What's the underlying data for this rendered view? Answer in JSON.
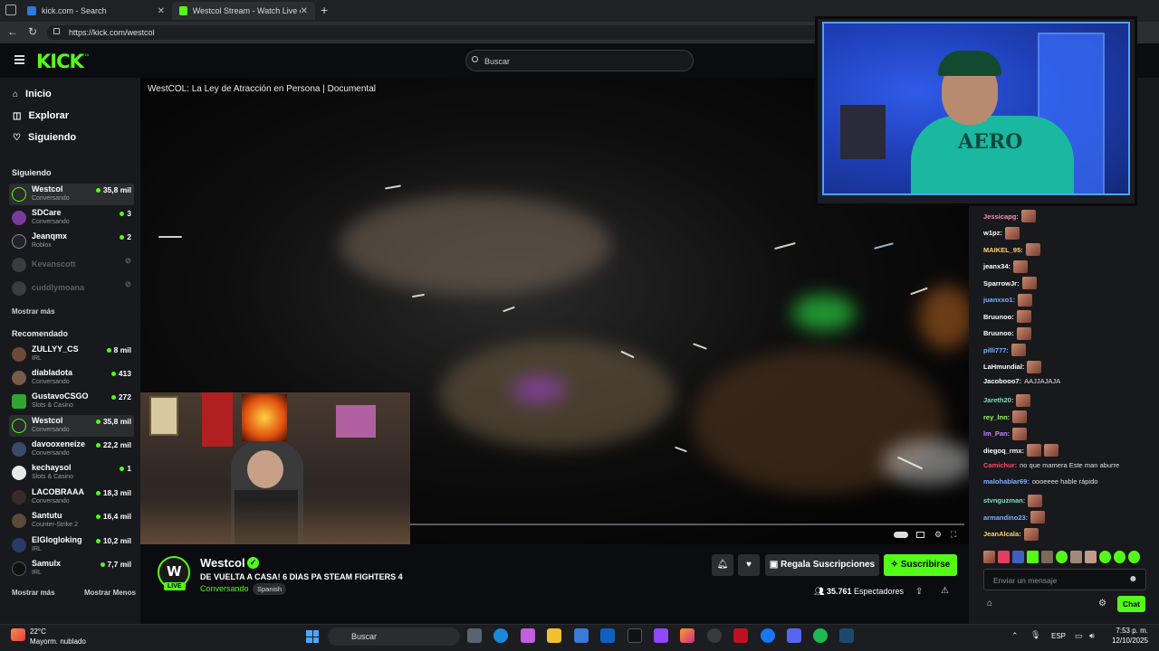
{
  "browser": {
    "tabs": [
      {
        "label": "kick.com - Search"
      },
      {
        "label": "Westcol Stream - Watch Live on K"
      }
    ],
    "url": "https://kick.com/westcol"
  },
  "header": {
    "logo": "KICK",
    "logo_badge": "BETA",
    "search_placeholder": "Buscar"
  },
  "sidebar": {
    "nav": [
      {
        "label": "Inicio",
        "icon": "home-icon"
      },
      {
        "label": "Explorar",
        "icon": "compass-icon"
      },
      {
        "label": "Siguiendo",
        "icon": "heart-icon"
      }
    ],
    "following_title": "Siguiendo",
    "following": [
      {
        "name": "Westcol",
        "category": "Conversando",
        "viewers": "35,8 mil"
      },
      {
        "name": "SDCare",
        "category": "Conversando",
        "viewers": "3"
      },
      {
        "name": "Jeanqmx",
        "category": "Roblox",
        "viewers": "2"
      },
      {
        "name": "Kevanscott",
        "category": "",
        "viewers": ""
      },
      {
        "name": "cuddlymoana",
        "category": "",
        "viewers": ""
      }
    ],
    "show_more": "Mostrar más",
    "recommended_title": "Recomendado",
    "recommended": [
      {
        "name": "ZULLYY_CS",
        "category": "IRL",
        "viewers": "8 mil"
      },
      {
        "name": "diabladota",
        "category": "Conversando",
        "viewers": "413"
      },
      {
        "name": "GustavoCSGO",
        "category": "Slots & Casino",
        "viewers": "272"
      },
      {
        "name": "Westcol",
        "category": "Conversando",
        "viewers": "35,8 mil"
      },
      {
        "name": "davooxeneize",
        "category": "Conversando",
        "viewers": "22,2 mil"
      },
      {
        "name": "kechaysol",
        "category": "Slots & Casino",
        "viewers": "1"
      },
      {
        "name": "LACOBRAAA",
        "category": "Conversando",
        "viewers": "18,3 mil"
      },
      {
        "name": "Santutu",
        "category": "Counter-Strike 2",
        "viewers": "16,4 mil"
      },
      {
        "name": "ElGlogloking",
        "category": "IRL",
        "viewers": "10,2 mil"
      },
      {
        "name": "Samulx",
        "category": "IRL",
        "viewers": "7,7 mil"
      }
    ],
    "show_more_2": "Mostrar más",
    "show_less": "Mostrar Menos"
  },
  "video": {
    "title": "WestCOL: La Ley de Atracción en Persona | Documental",
    "progress": 1.0
  },
  "stream": {
    "live_badge": "LIVE",
    "streamer": "Westcol",
    "title": "DE VUELTA A CASA! 6 DIAS PA STEAM FIGHTERS 4",
    "category": "Conversando",
    "language": "Spanish",
    "gift_label": "Regala Suscripciones",
    "subscribe_label": "Suscribirse",
    "viewers_count": "35.761",
    "viewers_label": "Espectadores"
  },
  "chat": {
    "messages": [
      {
        "user": "Jessicapg:",
        "color": "#ff8fb0",
        "text": "",
        "emotes": 1
      },
      {
        "user": "w1pz:",
        "color": "#ffffff",
        "text": "",
        "emotes": 1
      },
      {
        "user": "MAIKEL_95:",
        "color": "#ffd36a",
        "text": "",
        "emotes": 1
      },
      {
        "user": "jeanx34:",
        "color": "#ffffff",
        "text": "",
        "emotes": 1
      },
      {
        "user": "SparrowJr:",
        "color": "#ffffff",
        "text": "",
        "emotes": 1
      },
      {
        "user": "juanxxo1:",
        "color": "#7fb0ff",
        "text": "",
        "emotes": 1
      },
      {
        "user": "Bruunoo:",
        "color": "#ffffff",
        "text": "",
        "emotes": 1
      },
      {
        "user": "Bruunoo:",
        "color": "#ffffff",
        "text": "",
        "emotes": 1
      },
      {
        "user": "pilli777:",
        "color": "#7fb0ff",
        "text": "",
        "emotes": 1
      },
      {
        "user": "LaHmundial:",
        "color": "#ffffff",
        "text": "",
        "emotes": 1
      },
      {
        "user": "Jacobooo7:",
        "color": "#ffffff",
        "text": "AAJJAJAJA",
        "emotes": 0
      },
      {
        "user": "Jareth20:",
        "color": "#7fe0c0",
        "text": "",
        "emotes": 1
      },
      {
        "user": "rey_lnn:",
        "color": "#9cff6a",
        "text": "",
        "emotes": 1
      },
      {
        "user": "lm_Pan:",
        "color": "#c08aff",
        "text": "",
        "emotes": 1
      },
      {
        "user": "diegoq_rmx:",
        "color": "#ffffff",
        "text": "",
        "emotes": 2
      },
      {
        "user": "Camichur:",
        "color": "#ff4a6a",
        "text": "no que mamera Este man aburre",
        "emotes": 0
      },
      {
        "user": "malohablar69:",
        "color": "#7fb0ff",
        "text": "oooeeee hable rápido",
        "emotes": 0
      },
      {
        "user": "stvnguzman:",
        "color": "#7fe0c0",
        "text": "",
        "emotes": 1
      },
      {
        "user": "armandino23:",
        "color": "#7fb0ff",
        "text": "",
        "emotes": 1
      },
      {
        "user": "JeanAlcala:",
        "color": "#ffd36a",
        "text": "",
        "emotes": 1
      }
    ],
    "input_placeholder": "Enviar un mensaje",
    "send_label": "Chat"
  },
  "taskbar": {
    "temperature": "22°C",
    "weather": "Mayorm. nublado",
    "search": "Buscar",
    "lang": "ESP",
    "time": "7:53 p. m.",
    "date": "12/10/2025"
  }
}
